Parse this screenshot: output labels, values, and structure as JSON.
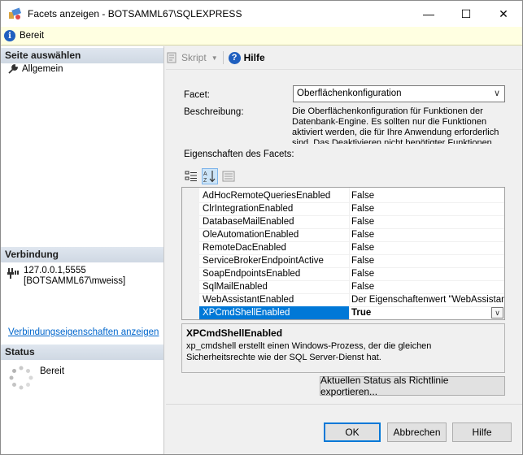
{
  "window": {
    "title": "Facets anzeigen - BOTSAMML67\\SQLEXPRESS",
    "minimize": "—",
    "maximize": "☐",
    "close": "✕"
  },
  "status_strip": {
    "text": "Bereit"
  },
  "left_pane": {
    "select_page_header": "Seite auswählen",
    "pages": [
      {
        "label": "Allgemein",
        "icon": "wrench-icon"
      }
    ],
    "connection_header": "Verbindung",
    "connection_server": "127.0.0.1,5555",
    "connection_user": "[BOTSAMML67\\mweiss]",
    "connection_link": "Verbindungseigenschaften anzeigen",
    "status_header": "Status",
    "status_text": "Bereit"
  },
  "toolbar": {
    "script_label": "Skript",
    "help_label": "Hilfe"
  },
  "facet": {
    "label": "Facet:",
    "selected": "Oberflächenkonfiguration",
    "description_label": "Beschreibung:",
    "description": "Die Oberflächenkonfiguration für Funktionen der Datenbank-Engine. Es sollten nur die Funktionen aktiviert werden, die für Ihre Anwendung erforderlich sind. Das Deaktivieren nicht benötigter Funktionen",
    "properties_label": "Eigenschaften des Facets:"
  },
  "properties": [
    {
      "name": "AdHocRemoteQueriesEnabled",
      "value": "False"
    },
    {
      "name": "ClrIntegrationEnabled",
      "value": "False"
    },
    {
      "name": "DatabaseMailEnabled",
      "value": "False"
    },
    {
      "name": "OleAutomationEnabled",
      "value": "False"
    },
    {
      "name": "RemoteDacEnabled",
      "value": "False"
    },
    {
      "name": "ServiceBrokerEndpointActive",
      "value": "False"
    },
    {
      "name": "SoapEndpointsEnabled",
      "value": "False"
    },
    {
      "name": "SqlMailEnabled",
      "value": "False"
    },
    {
      "name": "WebAssistantEnabled",
      "value": "Der Eigenschaftenwert \"WebAssistantEnabled\""
    },
    {
      "name": "XPCmdShellEnabled",
      "value": "True",
      "selected": true
    }
  ],
  "help_panel": {
    "title": "XPCmdShellEnabled",
    "description": "xp_cmdshell erstellt einen Windows-Prozess, der die gleichen Sicherheitsrechte wie der SQL Server-Dienst hat."
  },
  "buttons": {
    "export": "Aktuellen Status als Richtlinie exportieren...",
    "ok": "OK",
    "cancel": "Abbrechen",
    "help": "Hilfe"
  },
  "colors": {
    "selection": "#0078d7",
    "link": "#0066cc",
    "status_strip_bg": "#ffffe1"
  }
}
